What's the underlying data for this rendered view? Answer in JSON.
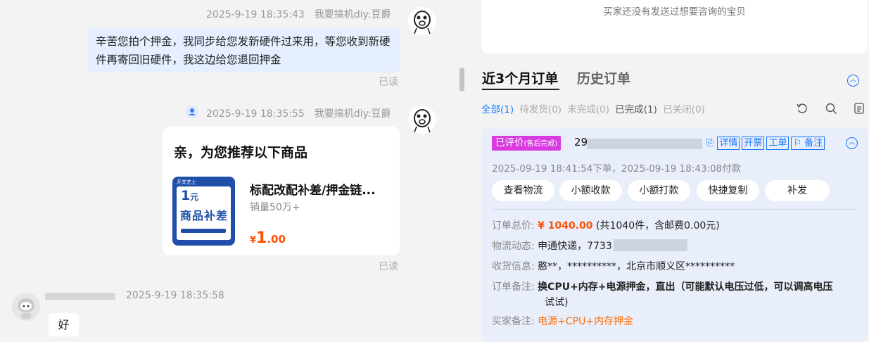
{
  "chat": {
    "msg1": {
      "time": "2025-9-19 18:35:43",
      "sender": "我要搞机diy:豆爵",
      "text": "辛苦您拍个押金，我同步给您发新硬件过来用，等您收到新硬件再寄回旧硬件，我这边给您退回押金",
      "read": "已读"
    },
    "msg2": {
      "time": "2025-9-19 18:35:55",
      "sender": "我要搞机diy:豆爵",
      "card_title": "亲，为您推荐以下商品",
      "product_name": "标配改配补差/押金链...",
      "sales": "销量50万+",
      "price_symbol": "¥",
      "price_int": "1",
      "price_dec": ".00",
      "thumb_brand": "开关艺士",
      "thumb_amount": "1",
      "thumb_unit": "元",
      "thumb_title": "商品补差",
      "read": "已读"
    },
    "msg3": {
      "time": "2025-9-19 18:35:58",
      "text": "好"
    }
  },
  "orders": {
    "top_notice": "买家还没有发送过想要咨询的宝贝",
    "tabs": [
      "近3个月订单",
      "历史订单"
    ],
    "filters": {
      "all": "全部(1)",
      "pending_ship": "待发货(0)",
      "incomplete": "未完成(0)",
      "completed": "已完成(1)",
      "closed": "已关闭(0)"
    },
    "icons": {
      "collapse": "chevron-up-icon",
      "refresh": "refresh-icon",
      "search": "search-icon",
      "note": "note-icon"
    },
    "order": {
      "status_main": "已评价",
      "status_sub": "(售后完成)",
      "order_no": "29",
      "links": [
        "详情",
        "开票",
        "工单",
        "备注"
      ],
      "time_text": "2025-09-19 18:41:54下单，2025-09-19 18:43:08付款",
      "buttons": [
        "查看物流",
        "小额收款",
        "小额打款",
        "快捷复制",
        "补发"
      ],
      "total_label": "订单总价:",
      "total_price": "¥ 1040.00",
      "total_detail": "(共1040件，含邮费0.00元)",
      "logistics_label": "物流动态:",
      "logistics_value": "申通快递，7733",
      "receiver_label": "收货信息:",
      "receiver_value": "憨**，**********，北京市顺义区**********",
      "seller_note_label": "订单备注:",
      "seller_note_line1": "换CPU+内存+电源押金，直出（可能默认电压过低，可以调高电压",
      "seller_note_line2": "试试)",
      "buyer_note_label": "买家备注:",
      "buyer_note_value": "电源+CPU+内存押金"
    },
    "colors": {
      "accent": "#1677ff",
      "price": "#ff5000",
      "badge": "#d93adf"
    }
  }
}
